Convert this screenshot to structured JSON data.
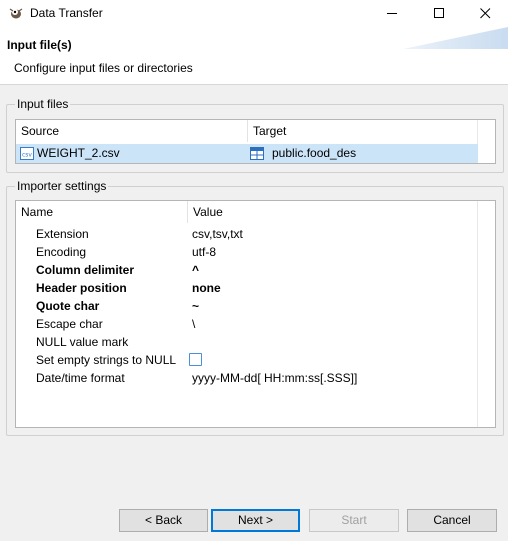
{
  "window": {
    "title": "Data Transfer",
    "controls": {
      "minimize": "—",
      "maximize": "☐",
      "close": "✕"
    }
  },
  "header": {
    "title": "Input file(s)",
    "description": "Configure input files or directories"
  },
  "input_files": {
    "group_label": "Input files",
    "columns": [
      "Source",
      "Target"
    ],
    "rows": [
      {
        "source": "WEIGHT_2.csv",
        "target": "public.food_des",
        "selected": true
      }
    ]
  },
  "importer_settings": {
    "group_label": "Importer settings",
    "columns": [
      "Name",
      "Value"
    ],
    "rows": [
      {
        "name": "Extension",
        "value": "csv,tsv,txt",
        "bold": false
      },
      {
        "name": "Encoding",
        "value": "utf-8",
        "bold": false
      },
      {
        "name": "Column delimiter",
        "value": "^",
        "bold": true
      },
      {
        "name": "Header position",
        "value": "none",
        "bold": true
      },
      {
        "name": "Quote char",
        "value": "~",
        "bold": true
      },
      {
        "name": "Escape char",
        "value": "\\",
        "bold": false
      },
      {
        "name": "NULL value mark",
        "value": "",
        "bold": false
      },
      {
        "name": "Set empty strings to NULL",
        "value": "",
        "bold": false,
        "checkbox": true,
        "checked": false
      },
      {
        "name": "Date/time format",
        "value": "yyyy-MM-dd[ HH:mm:ss[.SSS]]",
        "bold": false
      }
    ]
  },
  "buttons": {
    "back": "< Back",
    "next": "Next >",
    "start": "Start",
    "cancel": "Cancel"
  },
  "colors": {
    "selection": "#cce4f7",
    "accent": "#0078d7"
  }
}
